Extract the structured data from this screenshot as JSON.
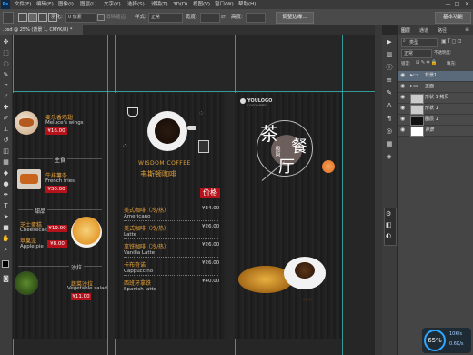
{
  "menubar": {
    "logo": "Ps",
    "items": [
      "文件(F)",
      "编辑(E)",
      "图像(I)",
      "图层(L)",
      "文字(Y)",
      "选择(S)",
      "滤镜(T)",
      "3D(D)",
      "视图(V)",
      "窗口(W)",
      "帮助(H)"
    ],
    "window_buttons": [
      "—",
      "□",
      "✕"
    ]
  },
  "optbar": {
    "feather_label": "羽化:",
    "feather_value": "0 像素",
    "antialias_label": "消除锯齿",
    "style_label": "样式:",
    "style_value": "正常",
    "width_label": "宽度:",
    "height_label": "高度:",
    "refine_edge": "调整边缘...",
    "workspace": "基本功能"
  },
  "document": {
    "tab_label": ".psd @ 25% (背景 1, CMYK/8) *"
  },
  "artwork": {
    "left_menu": [
      {
        "zh": "麦乐香鸡翅",
        "en": "Meluce's wings",
        "price": "¥16.00"
      },
      {
        "zh": "主食",
        "en": "",
        "price": ""
      },
      {
        "zh": "牛排薯条",
        "en": "French fries",
        "price": "¥30.00"
      },
      {
        "zh": "甜品",
        "en": "",
        "price": ""
      },
      {
        "zh": "芝士蛋糕",
        "en": "Cheesecake",
        "price": "¥19.00"
      },
      {
        "zh": "苹果派",
        "en": "Apple pie",
        "price": "¥8.00"
      },
      {
        "zh": "沙拉",
        "en": "",
        "price": ""
      },
      {
        "zh": "蔬菜沙拉",
        "en": "Vegetable salad",
        "price": "¥11.00"
      }
    ],
    "brand_en": "WISDOM COFFEE",
    "brand_zh": "韦斯顿咖啡",
    "price_header": "价格",
    "coffee_list": [
      {
        "zh": "美式咖啡（冷/热）",
        "en": "Americano",
        "price": "¥34.00"
      },
      {
        "zh": "美式咖啡（冷/热）",
        "en": "Latte",
        "price": "¥26.00"
      },
      {
        "zh": "拿铁咖啡（冷/热）",
        "en": "Vanilla Latte",
        "price": "¥26.00"
      },
      {
        "zh": "卡布奇诺",
        "en": "Cappuccino",
        "price": "¥26.00"
      },
      {
        "zh": "西班牙拿铁",
        "en": "Spanish latte",
        "price": "¥40.00"
      }
    ],
    "logo_text": "YOULOGO",
    "logo_sub": "LOGO HERE",
    "tea_big1": "茶",
    "tea_big2": "餐",
    "tea_big3": "厅",
    "tea_small": "极简"
  },
  "right_dock": {
    "tabs": [
      "图层",
      "通道",
      "路径"
    ],
    "filter_label": "类型",
    "blend_mode": "正常",
    "opacity_label": "不透明度:",
    "lock_label": "锁定:",
    "fill_label": "填充:",
    "layers": [
      {
        "name": "背景1",
        "selected": true
      },
      {
        "name": "正面",
        "selected": false
      },
      {
        "name": "形状 1 拷贝",
        "selected": false
      },
      {
        "name": "形状 1",
        "selected": false
      },
      {
        "name": "图层 1",
        "selected": false
      },
      {
        "name": "背景",
        "selected": false
      }
    ]
  },
  "zoom_widget": {
    "percent": "65%",
    "stat1": "10K/s",
    "stat2": "0.6K/s"
  },
  "colors": {
    "accent": "#31a8ff",
    "guide": "#39c0c0",
    "red": "#b5121b"
  }
}
